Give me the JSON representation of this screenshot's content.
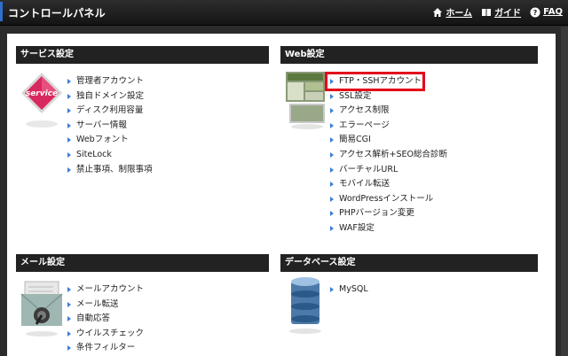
{
  "header": {
    "title": "コントロールパネル",
    "links": [
      {
        "label": "ホーム",
        "icon": "home-icon"
      },
      {
        "label": "ガイド",
        "icon": "book-icon"
      },
      {
        "label": "FAQ",
        "icon": "help-icon"
      }
    ]
  },
  "service": {
    "title": "サービス設定",
    "icon_text": "service",
    "items": [
      "管理者アカウント",
      "独自ドメイン設定",
      "ディスク利用容量",
      "サーバー情報",
      "Webフォント",
      "SiteLock",
      "禁止事項、制限事項"
    ]
  },
  "web": {
    "title": "Web設定",
    "items": [
      "FTP・SSHアカウント",
      "SSL設定",
      "アクセス制限",
      "エラーページ",
      "簡易CGI",
      "アクセス解析+SEO総合診断",
      "バーチャルURL",
      "モバイル転送",
      "WordPressインストール",
      "PHPバージョン変更",
      "WAF設定"
    ]
  },
  "mail": {
    "title": "メール設定",
    "items": [
      "メールアカウント",
      "メール転送",
      "自動応答",
      "ウイルスチェック",
      "条件フィルター"
    ]
  },
  "database": {
    "title": "データベース設定",
    "items": [
      "MySQL"
    ]
  },
  "colors": {
    "link_arrow": "#3a7fd8",
    "highlight": "#e3001b",
    "header_bg": "#222222"
  }
}
